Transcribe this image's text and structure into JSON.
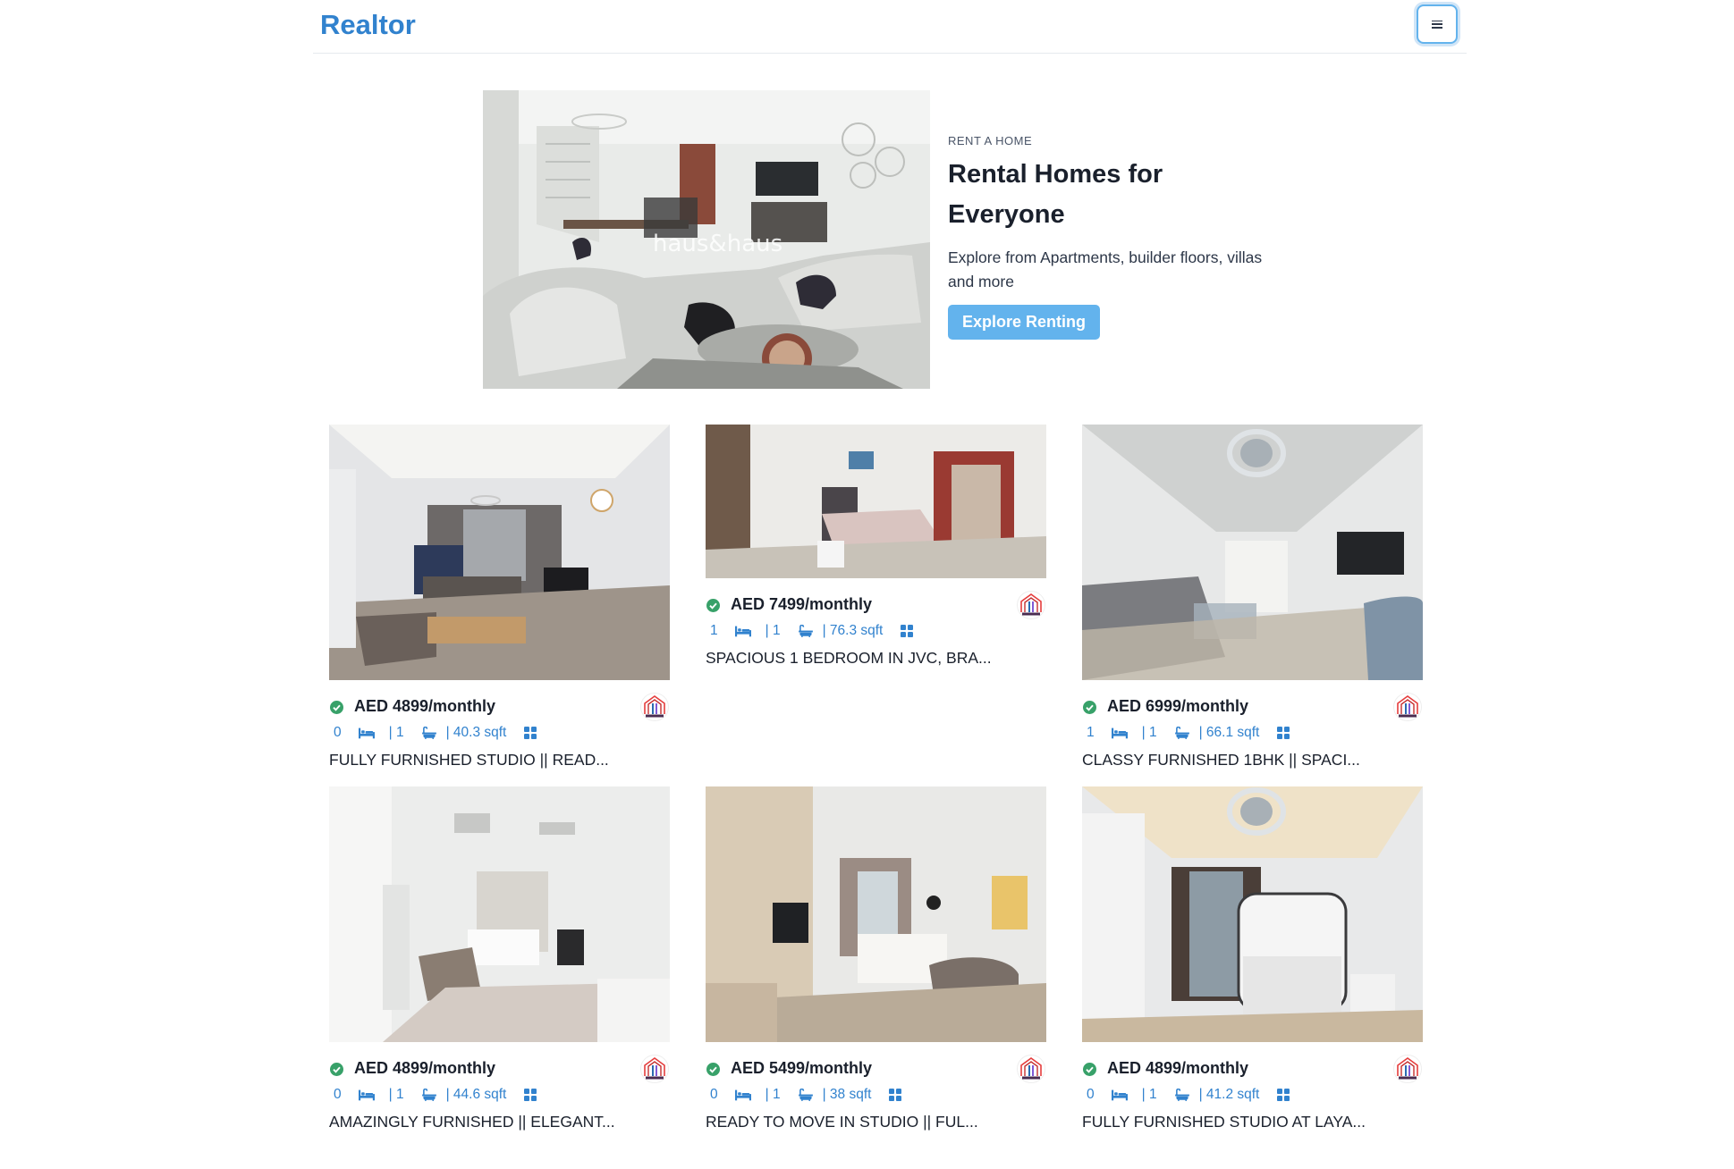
{
  "navbar": {
    "brand": "Realtor"
  },
  "banner": {
    "kicker": "RENT A HOME",
    "title_line1": "Rental Homes for",
    "title_line2": "Everyone",
    "description_line1": "Explore from Apartments, builder floors, villas",
    "description_line2": "and more",
    "button_label": "Explore Renting",
    "image_watermark": "haus&haus"
  },
  "colors": {
    "accent": "#3182ce",
    "button": "#63b3ed",
    "verified": "#38a169"
  },
  "icons": {
    "verified": "check-circle-icon",
    "rooms": "bed-icon",
    "baths": "bath-icon",
    "area": "grid-icon"
  },
  "listings": [
    {
      "price": "AED 4899/monthly",
      "rooms": "0",
      "baths": "| 1",
      "area": "| 40.3 sqft",
      "title": "FULLY FURNISHED STUDIO || READ..."
    },
    {
      "price": "AED 7499/monthly",
      "rooms": "1",
      "baths": "| 1",
      "area": "| 76.3 sqft",
      "title": "SPACIOUS 1 BEDROOM IN JVC, BRA..."
    },
    {
      "price": "AED 6999/monthly",
      "rooms": "1",
      "baths": "| 1",
      "area": "| 66.1 sqft",
      "title": "CLASSY FURNISHED 1BHK || SPACI..."
    },
    {
      "price": "AED 4899/monthly",
      "rooms": "0",
      "baths": "| 1",
      "area": "| 44.6 sqft",
      "title": "AMAZINGLY FURNISHED || ELEGANT..."
    },
    {
      "price": "AED 5499/monthly",
      "rooms": "0",
      "baths": "| 1",
      "area": "| 38 sqft",
      "title": "READY TO MOVE IN STUDIO || FUL..."
    },
    {
      "price": "AED 4899/monthly",
      "rooms": "0",
      "baths": "| 1",
      "area": "| 41.2 sqft",
      "title": "FULLY FURNISHED STUDIO AT LAYA..."
    }
  ]
}
